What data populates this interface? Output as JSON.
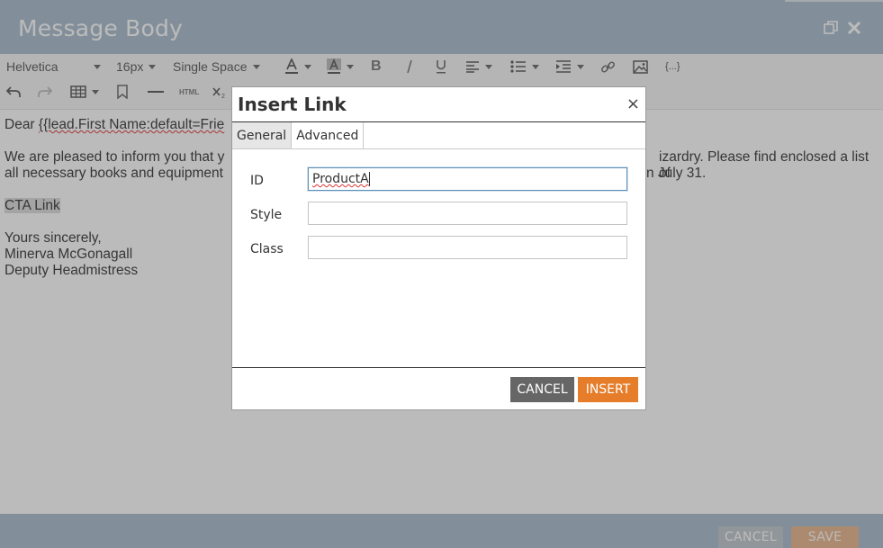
{
  "window": {
    "title": "Message Body"
  },
  "toolbar": {
    "font_family": "Helvetica",
    "font_size": "16px",
    "line_spacing": "Single Space",
    "html_label": "HTML",
    "token_label": "{...}"
  },
  "editor": {
    "greeting_prefix": "Dear ",
    "greeting_token": "{{lead.First Name:default=Frie",
    "paragraph_line1_left": "We are pleased to inform you that y",
    "paragraph_line1_right": "izardry. Please find enclosed a list of",
    "paragraph_line2_left": "all necessary books and equipment",
    "paragraph_line2_right": "n July 31.",
    "cta_link": "CTA Link",
    "closing": "Yours sincerely,",
    "signer_name": "Minerva McGonagall",
    "signer_title": "Deputy Headmistress"
  },
  "footer": {
    "cancel_label": "CANCEL",
    "save_label": "SAVE"
  },
  "dialog": {
    "title": "Insert Link",
    "close_glyph": "×",
    "tabs": [
      {
        "label": "General",
        "active": true
      },
      {
        "label": "Advanced",
        "active": false
      }
    ],
    "fields": {
      "id": {
        "label": "ID",
        "value": "ProductA"
      },
      "style": {
        "label": "Style",
        "value": ""
      },
      "class": {
        "label": "Class",
        "value": ""
      }
    },
    "cancel_label": "CANCEL",
    "insert_label": "INSERT"
  },
  "colors": {
    "header_bg": "#a8bccc",
    "insert_button": "#e57d2a",
    "cancel_button": "#666666",
    "focus_border": "#5b8fb8"
  }
}
